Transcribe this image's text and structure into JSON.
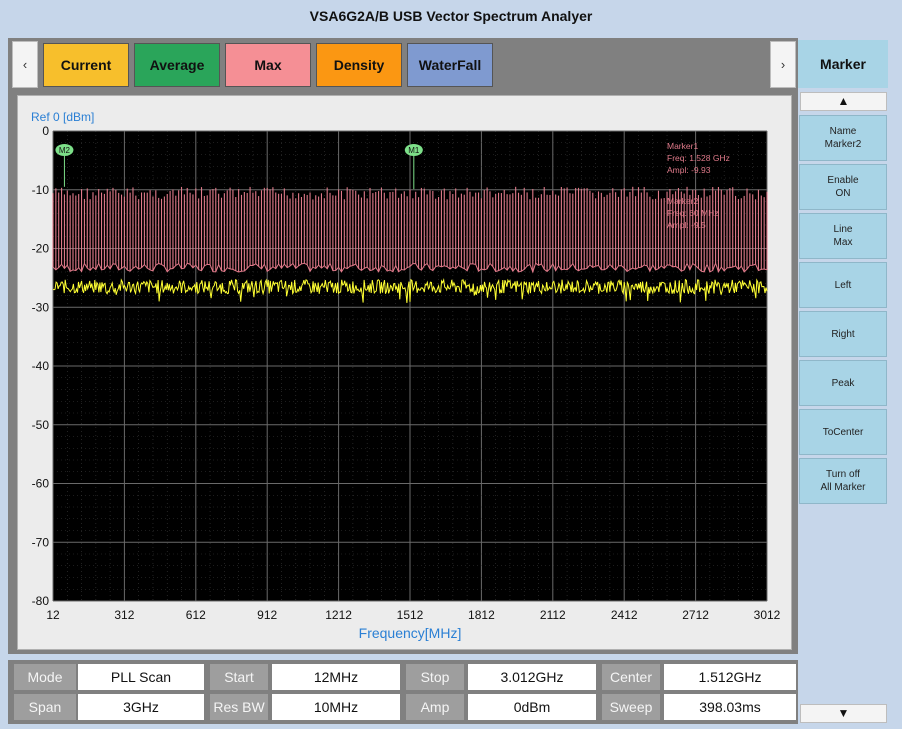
{
  "window": {
    "title": "VSA6G2A/B USB Vector Spectrum Analyer"
  },
  "tabs": {
    "prev_label": "‹",
    "next_label": "›",
    "items": [
      {
        "label": "Current",
        "color": "#f7bf2c"
      },
      {
        "label": "Average",
        "color": "#2aa55a"
      },
      {
        "label": "Max",
        "color": "#f58f95"
      },
      {
        "label": "Density",
        "color": "#fb9712"
      },
      {
        "label": "WaterFall",
        "color": "#7f9ad0"
      }
    ]
  },
  "marker_panel": {
    "title": "Marker",
    "up_label": "▲",
    "down_label": "▼",
    "buttons": [
      {
        "line1": "Name",
        "line2": "Marker2"
      },
      {
        "line1": "Enable",
        "line2": "ON"
      },
      {
        "line1": "Line",
        "line2": "Max"
      },
      {
        "line1": "Left",
        "line2": ""
      },
      {
        "line1": "Right",
        "line2": ""
      },
      {
        "line1": "Peak",
        "line2": ""
      },
      {
        "line1": "ToCenter",
        "line2": ""
      },
      {
        "line1": "Turn off",
        "line2": "All Marker"
      }
    ]
  },
  "chart_data": {
    "type": "line",
    "ref_label": "Ref  0 [dBm]",
    "xlabel": "Frequency[MHz]",
    "xlim": [
      12,
      3012
    ],
    "ylim": [
      -80,
      0
    ],
    "x_ticks": [
      "12",
      "312",
      "612",
      "912",
      "1212",
      "1512",
      "1812",
      "2112",
      "2412",
      "2712",
      "3012"
    ],
    "y_ticks": [
      "0",
      "-10",
      "-20",
      "-30",
      "-40",
      "-50",
      "-60",
      "-70",
      "-80"
    ],
    "grid": true,
    "background": "#000000",
    "series": [
      {
        "color": "#e07a8a",
        "comb_top_dbm": -9.5,
        "comb_bottom_dbm": -24,
        "comb_spacing_mhz": 12
      },
      {
        "color": "#ffff33",
        "mean_dbm": -26.5,
        "noise_dbm": 1.2
      }
    ],
    "markers": [
      {
        "label": "M2",
        "freq_mhz": 60,
        "ampl_dbm": -9.5
      },
      {
        "label": "M1",
        "freq_mhz": 1528,
        "ampl_dbm": -9.9
      }
    ],
    "marker_readouts": [
      {
        "l1": "Marker1",
        "l2": "Freq:  1.528 GHz",
        "l3": "Ampl: -9.93"
      },
      {
        "l1": "Marker2",
        "l2": "Freq:  60 MHz",
        "l3": "Ampl: -9.5"
      }
    ]
  },
  "params": {
    "row1": [
      {
        "label": "Mode",
        "value": "PLL Scan"
      },
      {
        "label": "Start",
        "value": "12MHz"
      },
      {
        "label": "Stop",
        "value": "3.012GHz"
      },
      {
        "label": "Center",
        "value": "1.512GHz"
      }
    ],
    "row2": [
      {
        "label": "Span",
        "value": "3GHz"
      },
      {
        "label": "Res BW",
        "value": "10MHz"
      },
      {
        "label": "Amp",
        "value": "0dBm"
      },
      {
        "label": "Sweep",
        "value": "398.03ms"
      }
    ]
  }
}
